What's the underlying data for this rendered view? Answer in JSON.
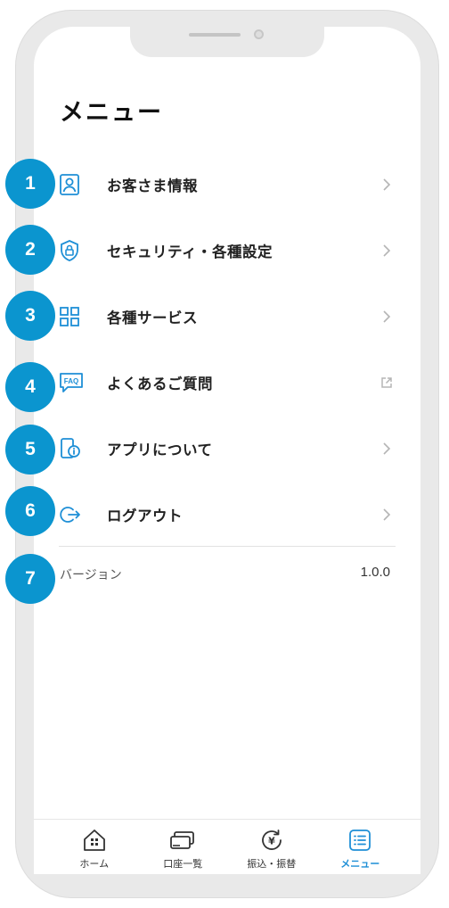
{
  "page": {
    "title": "メニュー"
  },
  "accent_color": "#0b95cf",
  "menu": {
    "items": [
      {
        "label": "お客さま情報",
        "icon": "user-card-icon",
        "trailing": "chevron-right-icon"
      },
      {
        "label": "セキュリティ・各種設定",
        "icon": "shield-lock-icon",
        "trailing": "chevron-right-icon"
      },
      {
        "label": "各種サービス",
        "icon": "grid-icon",
        "trailing": "chevron-right-icon"
      },
      {
        "label": "よくあるご質問",
        "icon": "faq-icon",
        "trailing": "external-link-icon"
      },
      {
        "label": "アプリについて",
        "icon": "phone-info-icon",
        "trailing": "chevron-right-icon"
      },
      {
        "label": "ログアウト",
        "icon": "logout-icon",
        "trailing": "chevron-right-icon"
      }
    ]
  },
  "version": {
    "label": "バージョン",
    "value": "1.0.0"
  },
  "badges": [
    "1",
    "2",
    "3",
    "4",
    "5",
    "6",
    "7"
  ],
  "tabbar": {
    "tabs": [
      {
        "label": "ホーム",
        "icon": "home-icon"
      },
      {
        "label": "口座一覧",
        "icon": "cards-icon"
      },
      {
        "label": "振込・振替",
        "icon": "yen-transfer-icon"
      },
      {
        "label": "メニュー",
        "icon": "menu-list-icon",
        "active": true
      }
    ]
  }
}
